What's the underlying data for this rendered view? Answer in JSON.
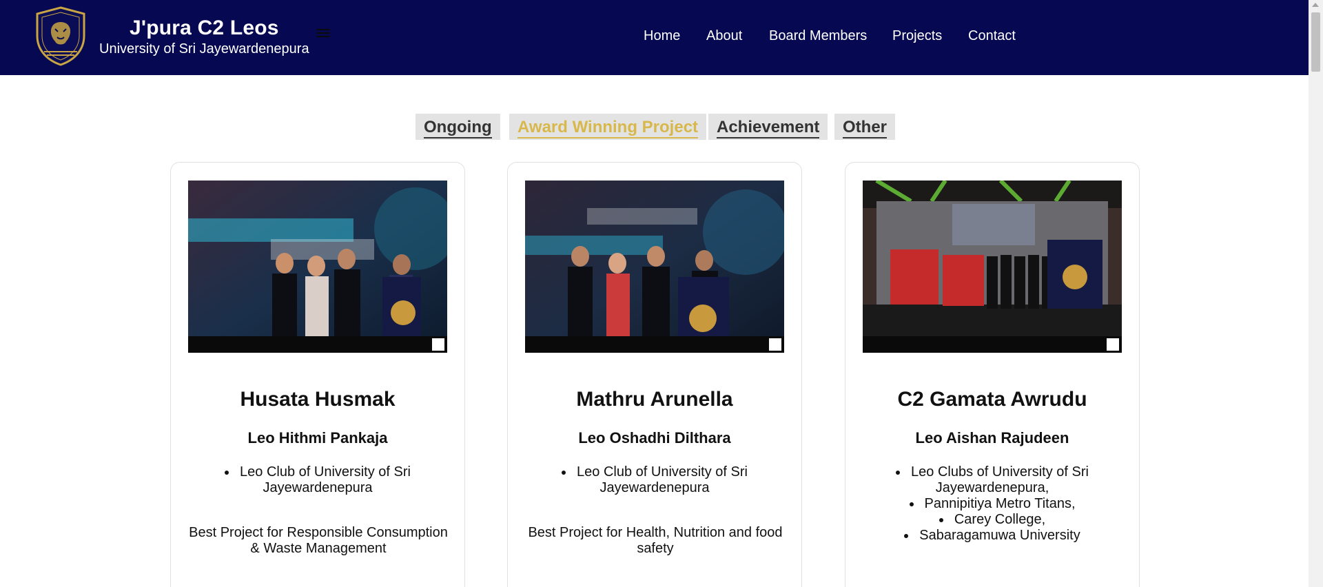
{
  "header": {
    "title": "J'pura C2 Leos",
    "subtitle": "University of Sri Jayewardenepura",
    "nav": [
      {
        "label": "Home"
      },
      {
        "label": "About"
      },
      {
        "label": "Board Members"
      },
      {
        "label": "Projects"
      },
      {
        "label": "Contact"
      }
    ]
  },
  "filters": [
    {
      "label": "Ongoing",
      "active": false
    },
    {
      "label": "Award Winning Project",
      "active": true
    },
    {
      "label": "Achievement",
      "active": false
    },
    {
      "label": "Other",
      "active": false
    }
  ],
  "projects": [
    {
      "title": "Husata Husmak",
      "leader": "Leo Hithmi Pankaja",
      "clubs": [
        "Leo Club of University of Sri Jayewardenepura"
      ],
      "award": "Best Project for Responsible Consumption & Waste Management"
    },
    {
      "title": "Mathru Arunella",
      "leader": "Leo Oshadhi Dilthara",
      "clubs": [
        "Leo Club of University of Sri Jayewardenepura"
      ],
      "award": "Best Project for Health, Nutrition and food safety"
    },
    {
      "title": "C2 Gamata Awrudu",
      "leader": "Leo Aishan Rajudeen",
      "clubs": [
        "Leo Clubs of University of Sri Jayewardenepura,",
        "Pannipitiya Metro Titans,",
        "Carey College,",
        "Sabaragamuwa University"
      ],
      "award": ""
    }
  ],
  "colors": {
    "header_bg": "#060851",
    "accent_gold": "#d8b84a",
    "tab_bg": "#e3e3e3"
  },
  "icons": {
    "logo": "lion-shield-logo",
    "menu": "hamburger-menu-icon"
  }
}
